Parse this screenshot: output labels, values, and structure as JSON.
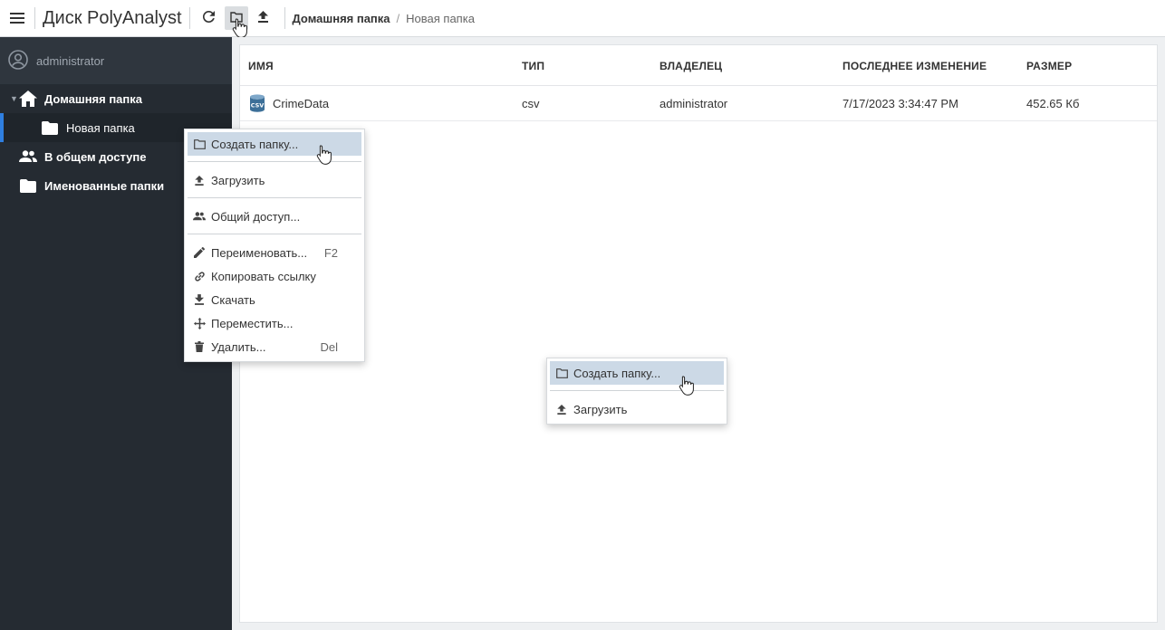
{
  "app": {
    "title": "Диск PolyAnalyst"
  },
  "toolbar": {
    "menu_icon": "hamburger-icon",
    "refresh_icon": "refresh-icon",
    "new_folder_icon": "new-folder-icon",
    "upload_icon": "upload-icon"
  },
  "breadcrumb": {
    "home": "Домашняя папка",
    "sep": "/",
    "current": "Новая папка"
  },
  "sidebar": {
    "user": "administrator",
    "items": [
      {
        "label": "Домашняя папка",
        "icon": "home-icon"
      },
      {
        "label": "Новая папка",
        "icon": "folder-icon"
      },
      {
        "label": "В общем доступе",
        "icon": "people-icon"
      },
      {
        "label": "Именованные папки",
        "icon": "folder-icon"
      }
    ]
  },
  "table": {
    "columns": [
      "ИМЯ",
      "ТИП",
      "ВЛАДЕЛЕЦ",
      "ПОСЛЕДНЕЕ ИЗМЕНЕНИЕ",
      "РАЗМЕР"
    ],
    "rows": [
      {
        "name": "CrimeData",
        "type": "csv",
        "owner": "administrator",
        "modified": "7/17/2023 3:34:47 PM",
        "size": "452.65 Кб"
      }
    ]
  },
  "context_menu_sidebar": {
    "items": [
      {
        "label": "Создать папку...",
        "icon": "folder-outline-icon"
      },
      {
        "label": "Загрузить",
        "icon": "upload-icon"
      },
      {
        "label": "Общий доступ...",
        "icon": "people-icon"
      },
      {
        "label": "Переименовать...",
        "icon": "pencil-icon",
        "shortcut": "F2"
      },
      {
        "label": "Копировать ссылку",
        "icon": "link-icon"
      },
      {
        "label": "Скачать",
        "icon": "download-icon"
      },
      {
        "label": "Переместить...",
        "icon": "move-icon"
      },
      {
        "label": "Удалить...",
        "icon": "trash-icon",
        "shortcut": "Del"
      }
    ]
  },
  "context_menu_main": {
    "items": [
      {
        "label": "Создать папку...",
        "icon": "folder-outline-icon"
      },
      {
        "label": "Загрузить",
        "icon": "upload-icon"
      }
    ]
  }
}
